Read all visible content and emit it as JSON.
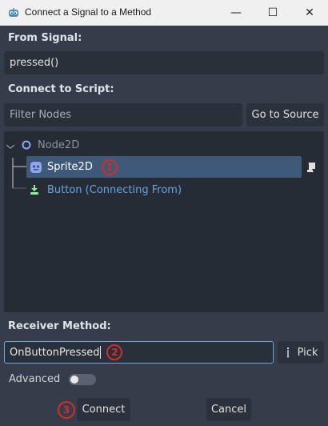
{
  "window": {
    "title": "Connect a Signal to a Method",
    "controls": {
      "minimize": "—",
      "maximize": "☐",
      "close": "✕"
    }
  },
  "from_signal": {
    "label": "From Signal:",
    "value": "pressed()"
  },
  "connect_to_script": {
    "label": "Connect to Script:",
    "filter_placeholder": "Filter Nodes",
    "go_to_source": "Go to Source"
  },
  "tree": {
    "root": {
      "label": "Node2D"
    },
    "selected": {
      "label": "Sprite2D",
      "marker": "1"
    },
    "source": {
      "label": "Button (Connecting From)"
    }
  },
  "receiver_method": {
    "label": "Receiver Method:",
    "value": "OnButtonPressed",
    "marker": "2",
    "pick_label": "Pick"
  },
  "advanced": {
    "label": "Advanced",
    "enabled": false
  },
  "footer": {
    "connect_label": "Connect",
    "connect_marker": "3",
    "cancel_label": "Cancel"
  },
  "colors": {
    "dialog_bg": "#363d4a",
    "field_bg": "#2a303a",
    "tree_selected": "#3f5978",
    "link_blue": "#6aa3e0",
    "marker_red": "#d52b2b",
    "focus_border": "#6ba7e6"
  }
}
